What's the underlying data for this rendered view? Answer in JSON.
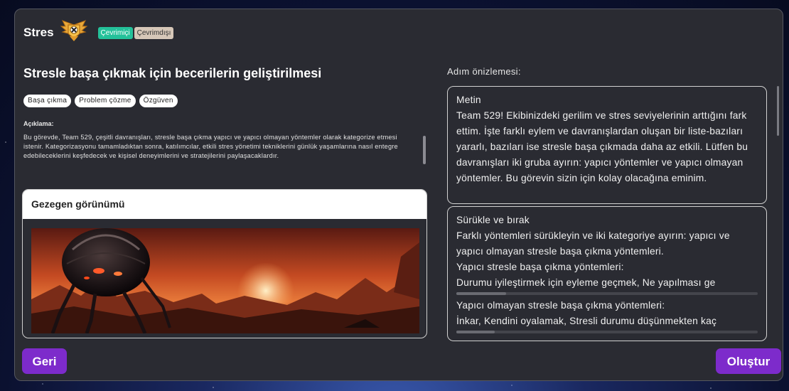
{
  "app": {
    "title": "Stres",
    "status_online": "Çevrimiçi",
    "status_offline": "Çevrimdışı"
  },
  "task": {
    "title": "Stresle başa çıkmak için becerilerin geliştirilmesi",
    "tags": [
      "Başa çıkma",
      "Problem çözme",
      "Özgüven"
    ],
    "description_label": "Açıklama:",
    "description": "Bu görevde, Team 529, çeşitli davranışları, stresle başa çıkma yapıcı ve yapıcı olmayan yöntemler olarak kategorize etmesi istenir. Kategorizasyonu tamamladıktan sonra, katılımcılar, etkili stres yönetimi tekniklerini günlük yaşamlarına nasıl entegre edebileceklerini keşfedecek ve kişisel deneyimlerini ve stratejilerini paylaşacaklardır."
  },
  "planet_view": {
    "title": "Gezegen görünümü",
    "image_name": "alien-robot-planet-image"
  },
  "preview": {
    "label": "Adım önizlemesi:",
    "text_step": {
      "type": "Metin",
      "content": "Team 529! Ekibinizdeki gerilim ve stres seviyelerinin arttığını fark ettim. İşte farklı eylem ve davranışlardan oluşan bir liste-bazıları yararlı, bazıları ise stresle başa çıkmada daha az etkili. Lütfen bu davranışları iki gruba ayırın: yapıcı yöntemler ve yapıcı olmayan yöntemler. Bu görevin sizin için kolay olacağına eminim."
    },
    "drag_step": {
      "type": "Sürükle ve bırak",
      "instruction": "Farklı yöntemleri sürükleyin ve iki kategoriye ayırın: yapıcı ve yapıcı olmayan stresle başa çıkma yöntemleri.",
      "category1_title": "Yapıcı stresle başa çıkma yöntemleri:",
      "category1_items": "Durumu iyileştirmek için eyleme geçmek, Ne yapılması ge",
      "category2_title": "Yapıcı olmayan stresle başa çıkma yöntemleri:",
      "category2_items": "İnkar, Kendini oyalamak, Stresli durumu düşünmekten kaç"
    }
  },
  "buttons": {
    "back": "Geri",
    "create": "Oluştur"
  },
  "colors": {
    "accent_purple": "#7d2bcb",
    "online_green": "#24c19a",
    "offline_beige": "#d6c7b8",
    "panel_bg": "#2a2b32"
  }
}
